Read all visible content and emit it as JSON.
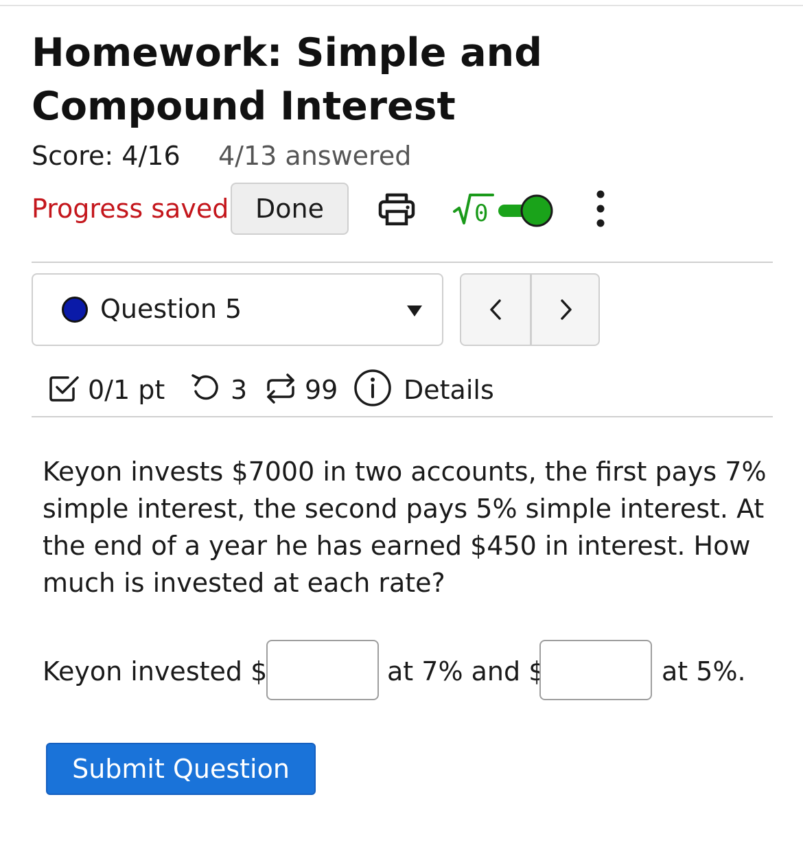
{
  "header": {
    "title": "Homework: Simple and Compound Interest",
    "score": "Score: 4/16",
    "answered": "4/13 answered",
    "progress_status": "Progress saved",
    "done_label": "Done",
    "toolbar_icons": [
      "printer-icon",
      "sqrt-icon",
      "toggle-switch",
      "more-vertical-icon"
    ],
    "toggle_on": true
  },
  "question_nav": {
    "selected": "Question 5",
    "status_dot_color": "#0a1aa8",
    "prev_symbol": "<",
    "next_symbol": ">"
  },
  "question_meta": {
    "points": "0/1 pt",
    "attempts": "3",
    "versions": "99",
    "details_label": "Details"
  },
  "question": {
    "text": "Keyon invests $7000 in two accounts, the first pays 7% simple interest, the second pays 5% simple interest. At the end of a year he has earned $450 in interest. How much is invested at each rate?"
  },
  "answer": {
    "prefix": "Keyon invested $",
    "middle": "at 7% and $",
    "suffix": "at 5%.",
    "input1_value": "",
    "input2_value": ""
  },
  "submit_label": "Submit Question",
  "colors": {
    "accent": "#1a73d9",
    "saved": "#c4161c",
    "toggle_on": "#1aa31a"
  }
}
